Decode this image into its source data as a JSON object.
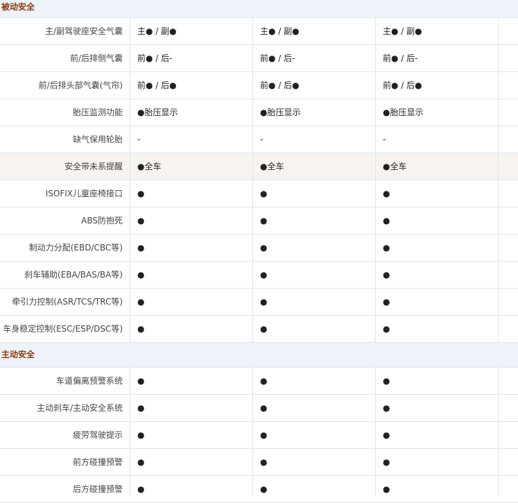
{
  "sections": [
    {
      "title": "被动安全",
      "rows": [
        {
          "label": "主/副驾驶座安全气囊",
          "values": [
            "主● / 副●",
            "主● / 副●",
            "主● / 副●"
          ]
        },
        {
          "label": "前/后排侧气囊",
          "values": [
            "前● / 后-",
            "前● / 后-",
            "前● / 后-"
          ]
        },
        {
          "label": "前/后排头部气囊(气帘)",
          "values": [
            "前● / 后●",
            "前● / 后●",
            "前● / 后●"
          ]
        },
        {
          "label": "胎压监测功能",
          "values": [
            "●胎压显示",
            "●胎压显示",
            "●胎压显示"
          ]
        },
        {
          "label": "缺气保用轮胎",
          "values": [
            "-",
            "-",
            "-"
          ]
        },
        {
          "label": "安全带未系提醒",
          "values": [
            "●全车",
            "●全车",
            "●全车"
          ]
        },
        {
          "label": "ISOFIX儿童座椅接口",
          "values": [
            "●",
            "●",
            "●"
          ]
        },
        {
          "label": "ABS防抱死",
          "values": [
            "●",
            "●",
            "●"
          ]
        },
        {
          "label": "制动力分配(EBD/CBC等)",
          "values": [
            "●",
            "●",
            "●"
          ]
        },
        {
          "label": "刹车辅助(EBA/BAS/BA等)",
          "values": [
            "●",
            "●",
            "●"
          ]
        },
        {
          "label": "牵引力控制(ASR/TCS/TRC等)",
          "values": [
            "●",
            "●",
            "●"
          ]
        },
        {
          "label": "车身稳定控制(ESC/ESP/DSC等)",
          "values": [
            "●",
            "●",
            "●"
          ]
        }
      ]
    },
    {
      "title": "主动安全",
      "rows": [
        {
          "label": "车道偏离预警系统",
          "values": [
            "●",
            "●",
            "●"
          ]
        },
        {
          "label": "主动刹车/主动安全系统",
          "values": [
            "●",
            "●",
            "●"
          ]
        },
        {
          "label": "疲劳驾驶提示",
          "values": [
            "●",
            "●",
            "●"
          ]
        },
        {
          "label": "前方碰撞预警",
          "values": [
            "●",
            "●",
            "●"
          ]
        },
        {
          "label": "后方碰撞预警",
          "values": [
            "●",
            "●",
            "●"
          ]
        }
      ]
    }
  ]
}
